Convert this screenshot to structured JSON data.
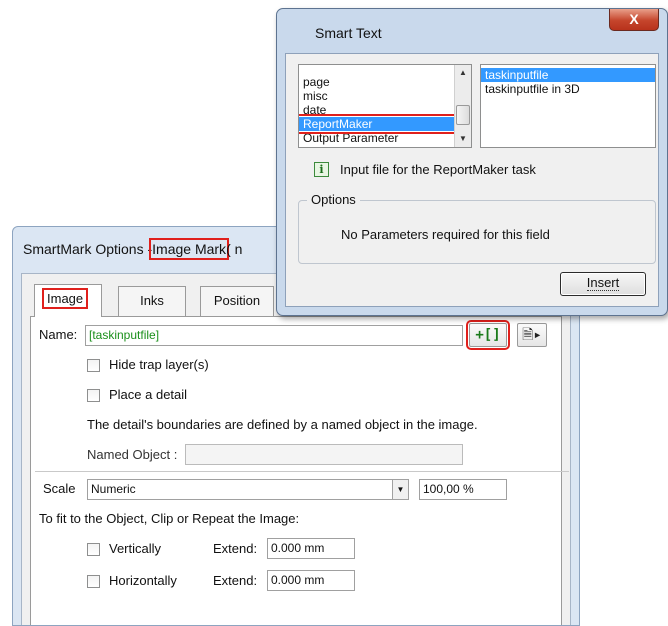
{
  "smartmark": {
    "title_prefix": "SmartMark Options - ",
    "title_highlight": "Image Mark",
    "title_suffix": " (  n",
    "tabs": [
      {
        "label": "Image"
      },
      {
        "label": "Inks"
      },
      {
        "label": "Position"
      }
    ],
    "name_label": "Name:",
    "name_value": "[taskinputfile]",
    "smart_text_button": "+[]",
    "hide_trap_label": "Hide trap layer(s)",
    "place_detail_label": "Place a detail",
    "detail_info": "The detail's boundaries are defined by a named object in the image.",
    "named_object_label": "Named Object :",
    "named_object_value": "",
    "scale_label": "Scale",
    "scale_value": "Numeric",
    "scale_percent": "100,00 %",
    "fit_label": "To fit to the Object, Clip or Repeat the Image:",
    "vertically_label": "Vertically",
    "horizontally_label": "Horizontally",
    "extend_label": "Extend:",
    "extend_vertical_value": "0.000 mm",
    "extend_horizontal_value": "0.000 mm"
  },
  "smart_text": {
    "title": "Smart Text",
    "close_label": "X",
    "categories": [
      "page",
      "misc",
      "date",
      "ReportMaker",
      "Output Parameter"
    ],
    "selected_category": "ReportMaker",
    "fields": [
      "taskinputfile",
      "taskinputfile in 3D"
    ],
    "selected_field": "taskinputfile",
    "info_icon": "i",
    "description": "Input file for the ReportMaker task",
    "options_label": "Options",
    "options_text": "No Parameters required for this field",
    "insert_label": "Insert"
  },
  "colors": {
    "highlight": "#e0201c",
    "name_text": "#1a8f1a",
    "selection": "#3399ff"
  }
}
